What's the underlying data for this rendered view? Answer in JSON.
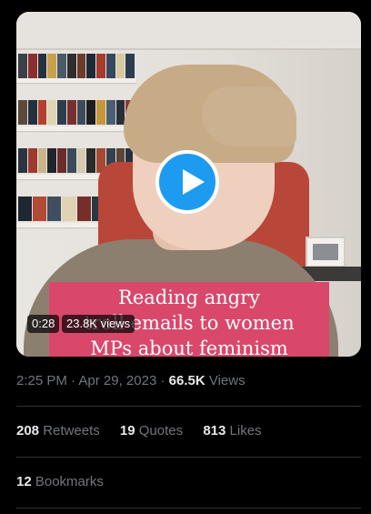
{
  "video": {
    "caption": "Reading angry\ntroll emails to women\nMPs about feminism",
    "duration": "0:28",
    "views": "23.8K views"
  },
  "post": {
    "time": "2:25 PM",
    "date": "Apr 29, 2023",
    "views_count": "66.5K",
    "views_label": "Views"
  },
  "stats": {
    "retweets_count": "208",
    "retweets_label": "Retweets",
    "quotes_count": "19",
    "quotes_label": "Quotes",
    "likes_count": "813",
    "likes_label": "Likes",
    "bookmarks_count": "12",
    "bookmarks_label": "Bookmarks"
  },
  "colors": {
    "accent": "#1d9bf0",
    "caption_bg": "#d9486b",
    "muted_text": "#71767b"
  },
  "icons": [
    "play-icon"
  ]
}
